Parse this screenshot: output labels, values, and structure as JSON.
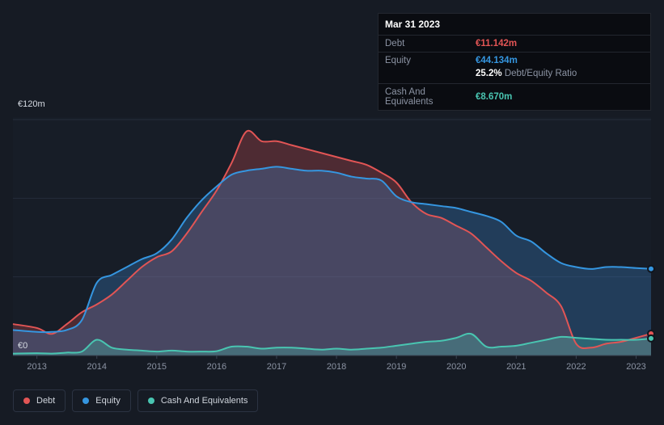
{
  "tooltip": {
    "date": "Mar 31 2023",
    "debt_label": "Debt",
    "debt_value": "€11.142m",
    "equity_label": "Equity",
    "equity_value": "€44.134m",
    "ratio_value": "25.2%",
    "ratio_label": "Debt/Equity Ratio",
    "cash_label": "Cash And Equivalents",
    "cash_value": "€8.670m"
  },
  "legend": {
    "items": [
      {
        "label": "Debt",
        "color": "#e25555"
      },
      {
        "label": "Equity",
        "color": "#3596e0"
      },
      {
        "label": "Cash And Equivalents",
        "color": "#49c5b1"
      }
    ]
  },
  "chart_data": {
    "type": "area",
    "title": "",
    "xlabel": "",
    "ylabel": "",
    "ylim": [
      0,
      120
    ],
    "ytick_labels": [
      "€120m",
      "€0"
    ],
    "grid_values": [
      120,
      80,
      40
    ],
    "xticks": [
      2013,
      2014,
      2015,
      2016,
      2017,
      2018,
      2019,
      2020,
      2021,
      2022,
      2023
    ],
    "legend_position": "bottom-left",
    "grid": true,
    "x": [
      2012.6,
      2013.0,
      2013.25,
      2013.5,
      2013.75,
      2014.0,
      2014.25,
      2014.5,
      2014.75,
      2015.0,
      2015.25,
      2015.5,
      2015.75,
      2016.0,
      2016.25,
      2016.5,
      2016.75,
      2017.0,
      2017.25,
      2017.5,
      2017.75,
      2018.0,
      2018.25,
      2018.5,
      2018.75,
      2019.0,
      2019.25,
      2019.5,
      2019.75,
      2020.0,
      2020.25,
      2020.5,
      2020.75,
      2021.0,
      2021.25,
      2021.5,
      2021.75,
      2022.0,
      2022.25,
      2022.5,
      2022.75,
      2023.0,
      2023.25
    ],
    "series": [
      {
        "name": "Debt",
        "color": "#e25555",
        "fill": "rgba(224,82,82,0.28)",
        "values": [
          16,
          14,
          11,
          16,
          22,
          26,
          31,
          38,
          45,
          50,
          53,
          62,
          73,
          84,
          98,
          114,
          109,
          109,
          107,
          105,
          103,
          101,
          99,
          97,
          93,
          88,
          78,
          72,
          70,
          66,
          62,
          55,
          48,
          42,
          38,
          32,
          25,
          6,
          4,
          6,
          7,
          9,
          11.1
        ]
      },
      {
        "name": "Equity",
        "color": "#3596e0",
        "fill": "rgba(58,130,200,0.32)",
        "values": [
          13,
          12,
          12,
          13,
          18,
          37,
          41,
          45,
          49,
          52,
          59,
          70,
          79,
          86,
          92,
          94,
          95,
          96,
          95,
          94,
          94,
          93,
          91,
          90,
          89,
          81,
          78,
          77,
          76,
          75,
          73,
          71,
          68,
          61,
          58,
          52,
          47,
          45,
          44,
          45,
          45,
          44.5,
          44.1
        ]
      },
      {
        "name": "Cash And Equivalents",
        "color": "#49c5b1",
        "fill": "rgba(70,195,177,0.30)",
        "values": [
          1,
          1.2,
          1,
          1.5,
          2,
          8,
          4,
          3,
          2.5,
          2,
          2.5,
          2,
          2,
          2.2,
          4.5,
          4.5,
          3.5,
          4,
          4,
          3.5,
          3,
          3.5,
          3,
          3.5,
          4,
          5,
          6,
          7,
          7.5,
          9,
          11,
          4.5,
          4.5,
          5,
          6.5,
          8,
          9.5,
          9,
          8.5,
          8,
          8,
          8,
          8.7
        ]
      }
    ]
  }
}
